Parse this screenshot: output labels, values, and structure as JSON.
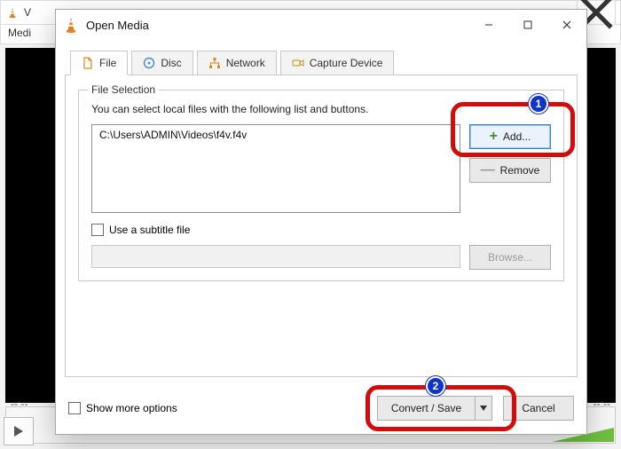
{
  "bg": {
    "title_prefix": "V",
    "menu_left": "Medi",
    "timecode_left": "--:--",
    "timecode_right": "--:--"
  },
  "dialog": {
    "title": "Open Media",
    "tabs": {
      "file": "File",
      "disc": "Disc",
      "network": "Network",
      "capture": "Capture Device"
    },
    "file_section": {
      "title": "File Selection",
      "hint": "You can select local files with the following list and buttons.",
      "files": [
        "C:\\Users\\ADMIN\\Videos\\f4v.f4v"
      ],
      "add_label": "Add...",
      "remove_label": "Remove"
    },
    "subtitle": {
      "checkbox_label": "Use a subtitle file",
      "browse_label": "Browse..."
    },
    "footer": {
      "more_options": "Show more options",
      "convert": "Convert / Save",
      "cancel": "Cancel"
    }
  },
  "annotations": {
    "step1": "1",
    "step2": "2"
  }
}
